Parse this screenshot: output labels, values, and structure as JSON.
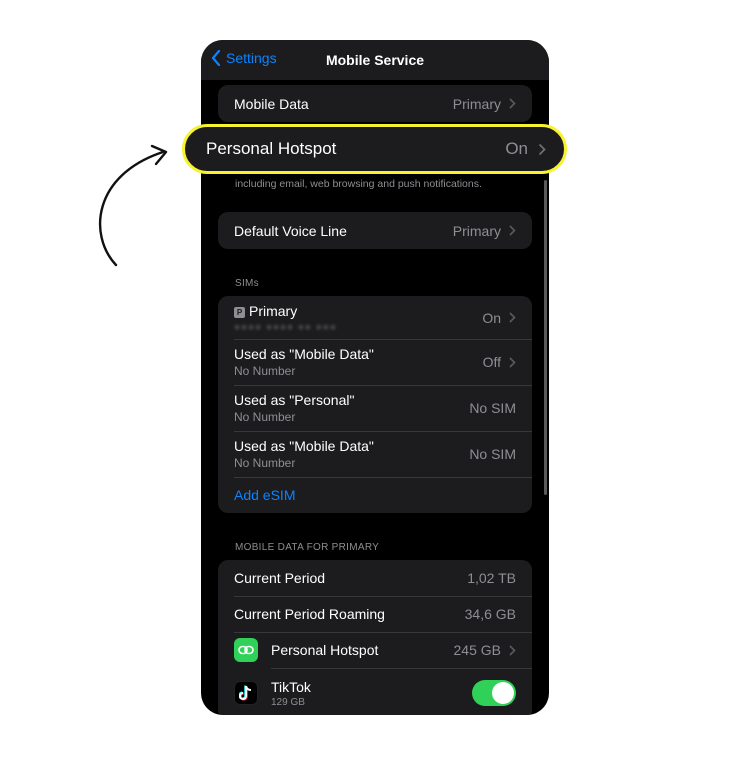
{
  "nav": {
    "back_label": "Settings",
    "title": "Mobile Service"
  },
  "top_group": {
    "mobile_data": {
      "label": "Mobile Data",
      "value": "Primary"
    }
  },
  "hotspot_highlight": {
    "label": "Personal Hotspot",
    "value": "On"
  },
  "hotspot_footer": "including email, web browsing and push notifications.",
  "voice_group": {
    "label": "Default Voice Line",
    "value": "Primary"
  },
  "sims": {
    "header": "SIMs",
    "badge": "P",
    "primary": {
      "label": "Primary",
      "value": "On"
    },
    "rows": [
      {
        "label": "Used as \"Mobile Data\"",
        "sub": "No Number",
        "value": "Off"
      },
      {
        "label": "Used as \"Personal\"",
        "sub": "No Number",
        "value": "No SIM"
      },
      {
        "label": "Used as \"Mobile Data\"",
        "sub": "No Number",
        "value": "No SIM"
      }
    ],
    "add_esim": "Add eSIM"
  },
  "usage": {
    "header": "MOBILE DATA FOR PRIMARY",
    "current_period": {
      "label": "Current Period",
      "value": "1,02 TB"
    },
    "current_period_roaming": {
      "label": "Current Period Roaming",
      "value": "34,6 GB"
    },
    "apps": [
      {
        "label": "Personal Hotspot",
        "value": "245 GB",
        "icon": "hotspot-icon"
      },
      {
        "label": "TikTok",
        "sub": "129 GB",
        "icon": "tiktok-icon",
        "enabled": true
      }
    ]
  },
  "colors": {
    "accent": "#0a84ff",
    "toggle_on": "#30d158",
    "highlight_border": "#f7f32f",
    "cell_bg": "#1c1c1e",
    "secondary_text": "#8e8e93"
  }
}
